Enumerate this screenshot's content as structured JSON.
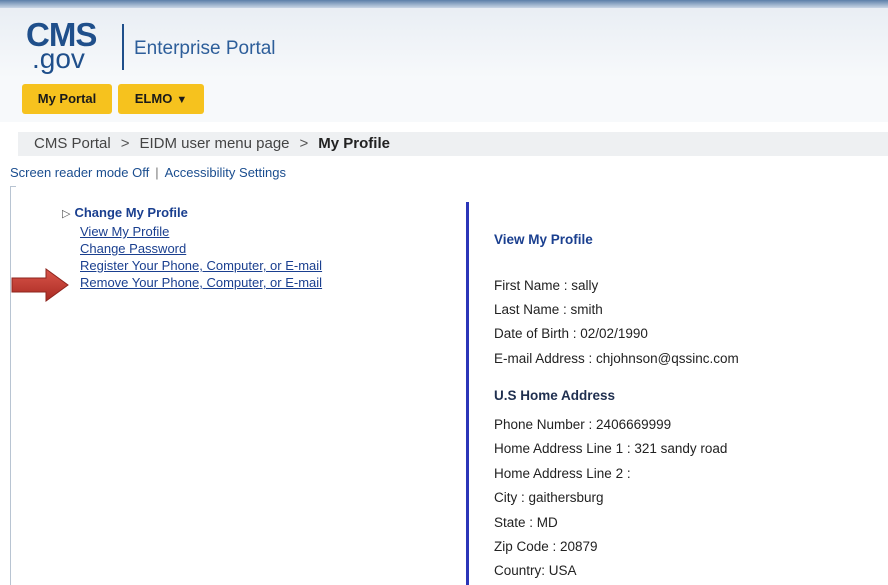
{
  "header": {
    "logo_top": "CMS",
    "logo_bottom": ".gov",
    "portal_name": "Enterprise Portal"
  },
  "nav": {
    "my_portal": "My Portal",
    "elmo": "ELMO",
    "elmo_caret": "▼"
  },
  "breadcrumb": {
    "items": [
      "CMS Portal",
      "EIDM user menu page",
      "My Profile"
    ],
    "separator": ">"
  },
  "accessibility": {
    "screen_reader": "Screen reader mode Off",
    "pipe": "|",
    "settings": "Accessibility Settings"
  },
  "menu": {
    "marker": "▷",
    "heading": "Change My Profile",
    "links": [
      "View My Profile",
      "Change Password",
      "Register Your Phone, Computer, or E-mail",
      "Remove Your Phone, Computer, or E-mail"
    ]
  },
  "profile": {
    "heading": "View My Profile",
    "fields": [
      "First Name :  sally",
      "Last Name :  smith",
      "Date of Birth :  02/02/1990",
      "E-mail Address :  chjohnson@qssinc.com"
    ],
    "address_heading": "U.S Home Address",
    "address_fields": [
      "Phone Number :  2406669999",
      "Home Address Line 1 :  321 sandy road",
      "Home Address Line 2 :",
      "City :  gaithersburg",
      "State :  MD",
      "Zip Code :  20879",
      "Country:  USA"
    ]
  },
  "colors": {
    "nav_button": "#f6c21e",
    "link": "#1a3f8f",
    "divider": "#2b35b8",
    "arrow": "#c0392b"
  }
}
